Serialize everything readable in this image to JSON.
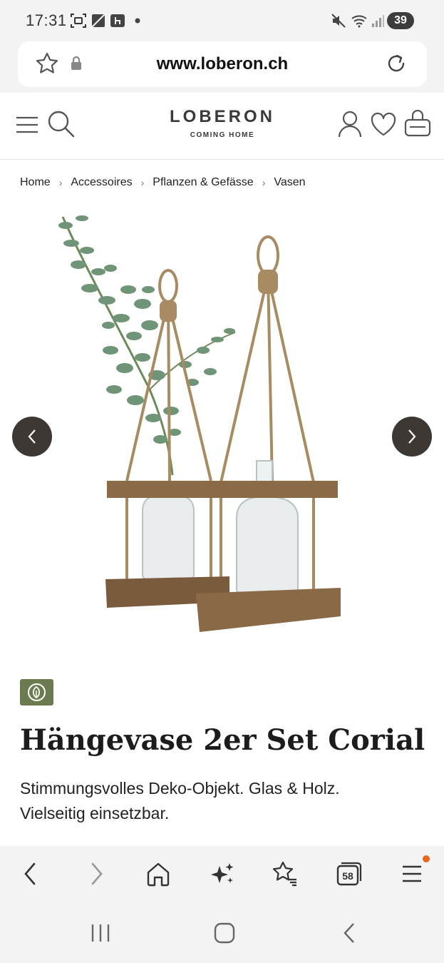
{
  "status_bar": {
    "time": "17:31",
    "battery": "39"
  },
  "browser": {
    "url": "www.loberon.ch",
    "tab_count": "58"
  },
  "header": {
    "logo_main": "LOBERON",
    "logo_sub": "COMING HOME"
  },
  "breadcrumb": [
    "Home",
    "Accessoires",
    "Pflanzen & Gefässe",
    "Vasen"
  ],
  "product": {
    "title": "Hängevase 2er Set Corial",
    "description": "Stimmungsvolles Deko-Objekt. Glas & Holz. Vielseitig einsetzbar."
  },
  "colors": {
    "accent": "#6b7b4f",
    "carousel": "#3d3834",
    "notification": "#e8661e"
  }
}
